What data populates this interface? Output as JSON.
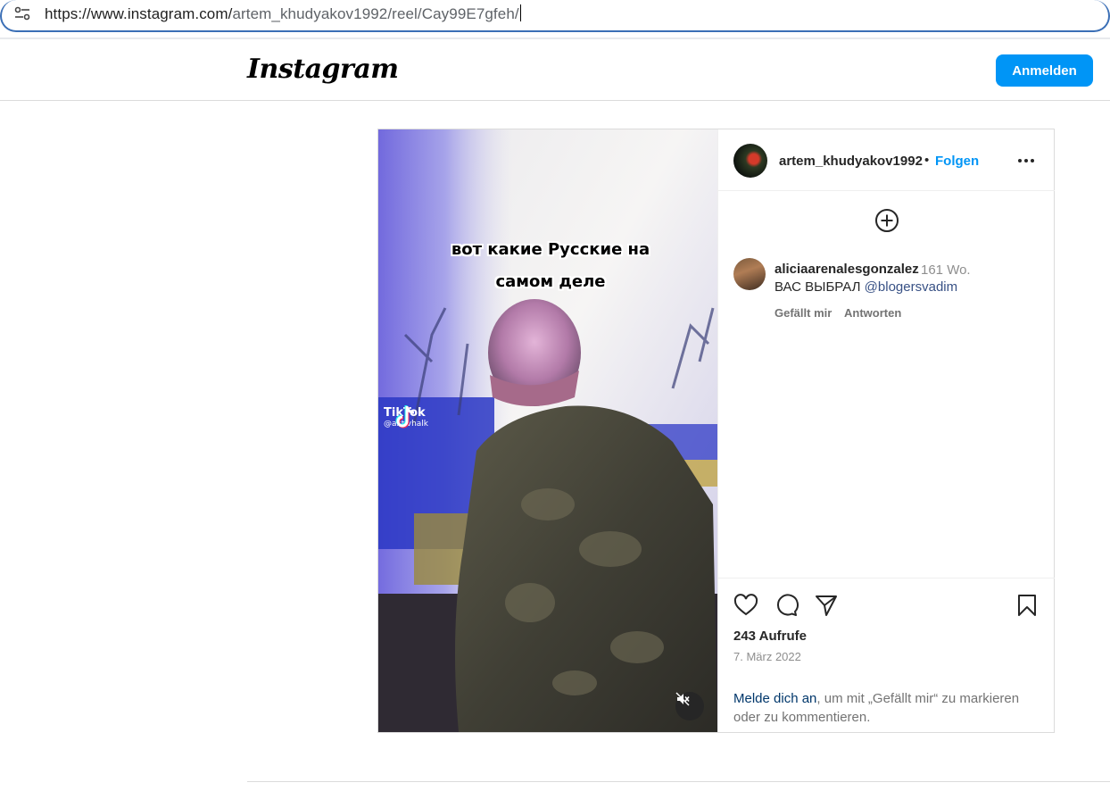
{
  "browser": {
    "url_host": "https://www.instagram.com/",
    "url_path": "artem_khudyakov1992/reel/Cay99E7gfeh/",
    "site_info_icon": "tune-icon"
  },
  "header": {
    "logo": "Instagram",
    "login_label": "Anmelden"
  },
  "media": {
    "overlay_caption": "вот какие Русские на самом деле",
    "tiktok_name": "TikTok",
    "tiktok_handle": "@aktivhalk",
    "mute_icon": "speaker-muted-icon"
  },
  "post": {
    "owner": "artem_khudyakov1992",
    "separator": "•",
    "follow_label": "Folgen",
    "more_icon": "more-horizontal-icon",
    "add_icon": "plus-circle-icon"
  },
  "comments": [
    {
      "user": "aliciaarenalesgonzalez",
      "time": "161 Wo.",
      "text": "ВАС ВЫБРАЛ ",
      "mention": "@blogersvadim",
      "like_label": "Gefällt mir",
      "reply_label": "Antworten"
    }
  ],
  "actions": {
    "views": "243 Aufrufe",
    "date": "7. März 2022",
    "login_link": "Melde dich an",
    "login_rest": ", um mit „Gefällt mir“ zu markieren oder zu kommentieren.",
    "icons": [
      "heart-icon",
      "comment-icon",
      "share-icon",
      "bookmark-icon"
    ]
  },
  "colors": {
    "accent": "#0095f6",
    "link_dark": "#00376b",
    "mention": "#385185",
    "muted": "#737373"
  }
}
